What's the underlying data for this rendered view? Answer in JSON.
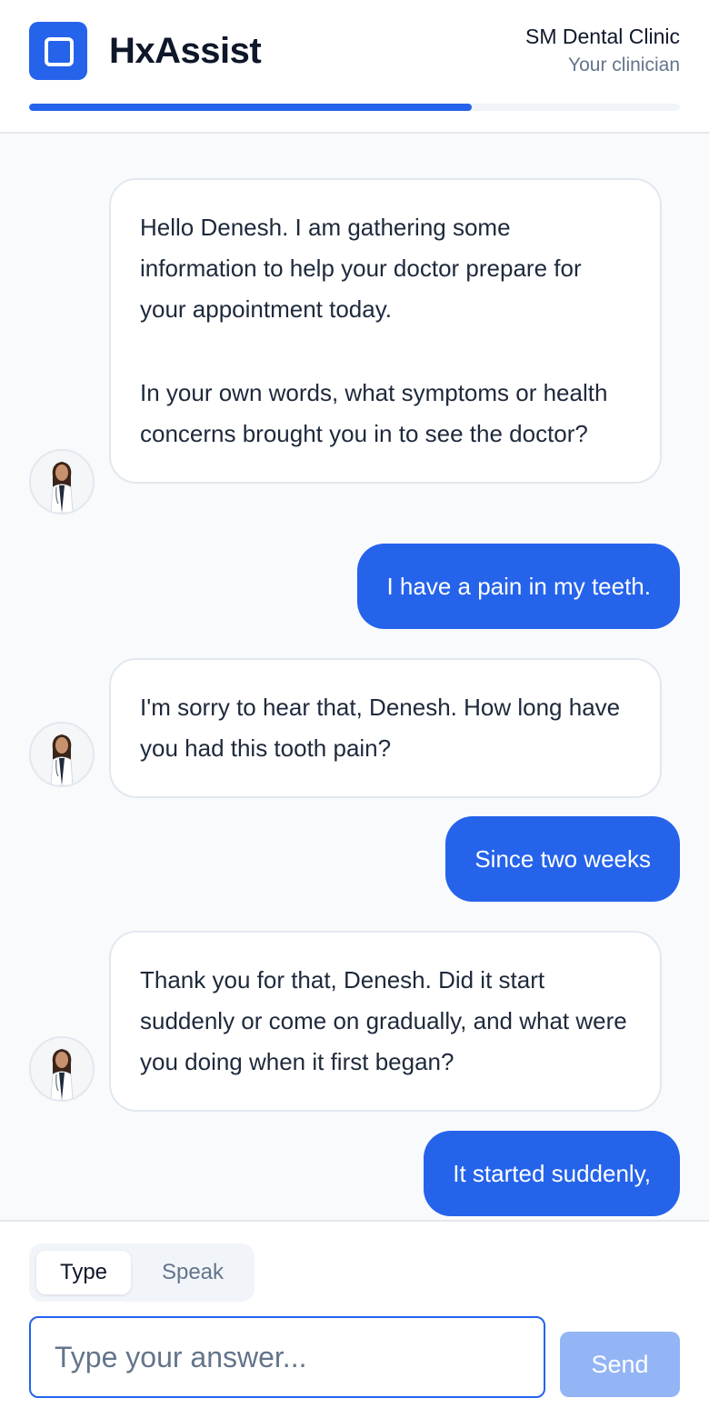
{
  "app": {
    "title": "HxAssist",
    "brand_color": "#2563eb"
  },
  "clinic": {
    "name": "SM Dental Clinic",
    "subtitle": "Your clinician"
  },
  "progress": {
    "fraction": 0.68
  },
  "messages": [
    {
      "role": "clinician",
      "paragraphs": [
        "Hello Denesh. I am gathering some information to help your doctor prepare for your appointment today.",
        "In your own words, what symptoms or health concerns brought you in to see the doctor?"
      ]
    },
    {
      "role": "patient",
      "text": "I have a pain in my teeth."
    },
    {
      "role": "clinician",
      "paragraphs": [
        "I'm sorry to hear that, Denesh. How long have you had this tooth pain?"
      ]
    },
    {
      "role": "patient",
      "text": "Since two weeks"
    },
    {
      "role": "clinician",
      "paragraphs": [
        "Thank you for that, Denesh. Did it start suddenly or come on gradually, and what were you doing when it first began?"
      ]
    },
    {
      "role": "patient",
      "text": "It started suddenly,"
    }
  ],
  "composer": {
    "modes": [
      "Type",
      "Speak"
    ],
    "active_mode": "Type",
    "input_placeholder": "Type your answer...",
    "input_value": "",
    "send_label": "Send"
  }
}
